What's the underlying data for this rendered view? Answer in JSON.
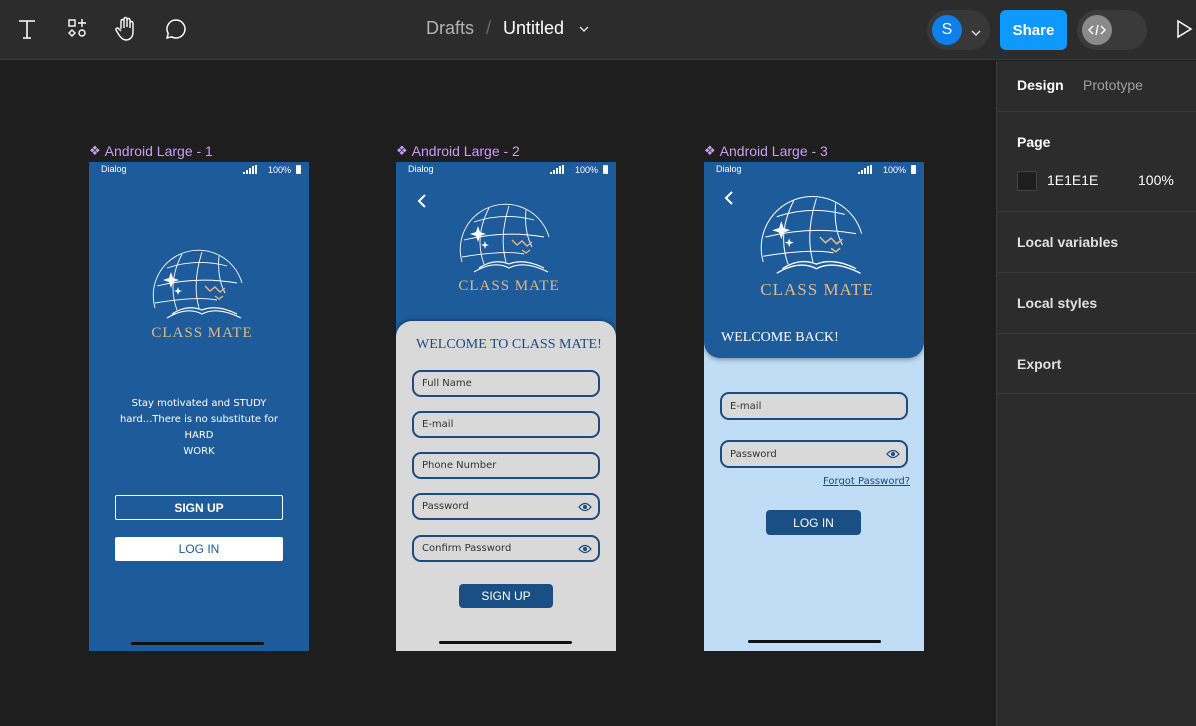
{
  "toolbar": {
    "tools": [
      "text-tool",
      "components-tool",
      "hand-tool",
      "comment-tool"
    ],
    "breadcrumb": {
      "parent": "Drafts",
      "separator": "/",
      "title": "Untitled"
    },
    "avatar_initial": "S",
    "share_label": "Share"
  },
  "canvas": {
    "frames": [
      {
        "label": "Android Large - 1",
        "status": {
          "carrier": "Dialog",
          "battery": "100%"
        },
        "logo": "CLASS MATE",
        "tagline_1": "Stay motivated and STUDY",
        "tagline_2": "hard...There is no substitute for HARD",
        "tagline_3": "WORK",
        "signup": "SIGN UP",
        "login": "LOG IN"
      },
      {
        "label": "Android Large - 2",
        "status": {
          "carrier": "Dialog",
          "battery": "100%"
        },
        "logo": "CLASS MATE",
        "welcome": "WELCOME TO CLASS MATE!",
        "fields": [
          "Full Name",
          "E-mail",
          "Phone Number",
          "Password",
          "Confirm Password"
        ],
        "signup": "SIGN UP"
      },
      {
        "label": "Android Large - 3",
        "status": {
          "carrier": "Dialog",
          "battery": "100%"
        },
        "logo": "CLASS MATE",
        "welcome": "WELCOME BACK!",
        "fields": [
          "E-mail",
          "Password"
        ],
        "forgot": "Forgot Password?",
        "login": "LOG IN"
      }
    ]
  },
  "panel": {
    "tabs": [
      "Design",
      "Prototype"
    ],
    "page": {
      "title": "Page",
      "color": "1E1E1E",
      "opacity": "100%"
    },
    "sections": [
      "Local variables",
      "Local styles",
      "Export"
    ]
  },
  "colors": {
    "frame_blue": "#1e5b9b",
    "light_blue": "#c1dcf5",
    "form_grey": "#d9d9d9",
    "accent": "#0d99ff",
    "gold": "#e0b884"
  }
}
